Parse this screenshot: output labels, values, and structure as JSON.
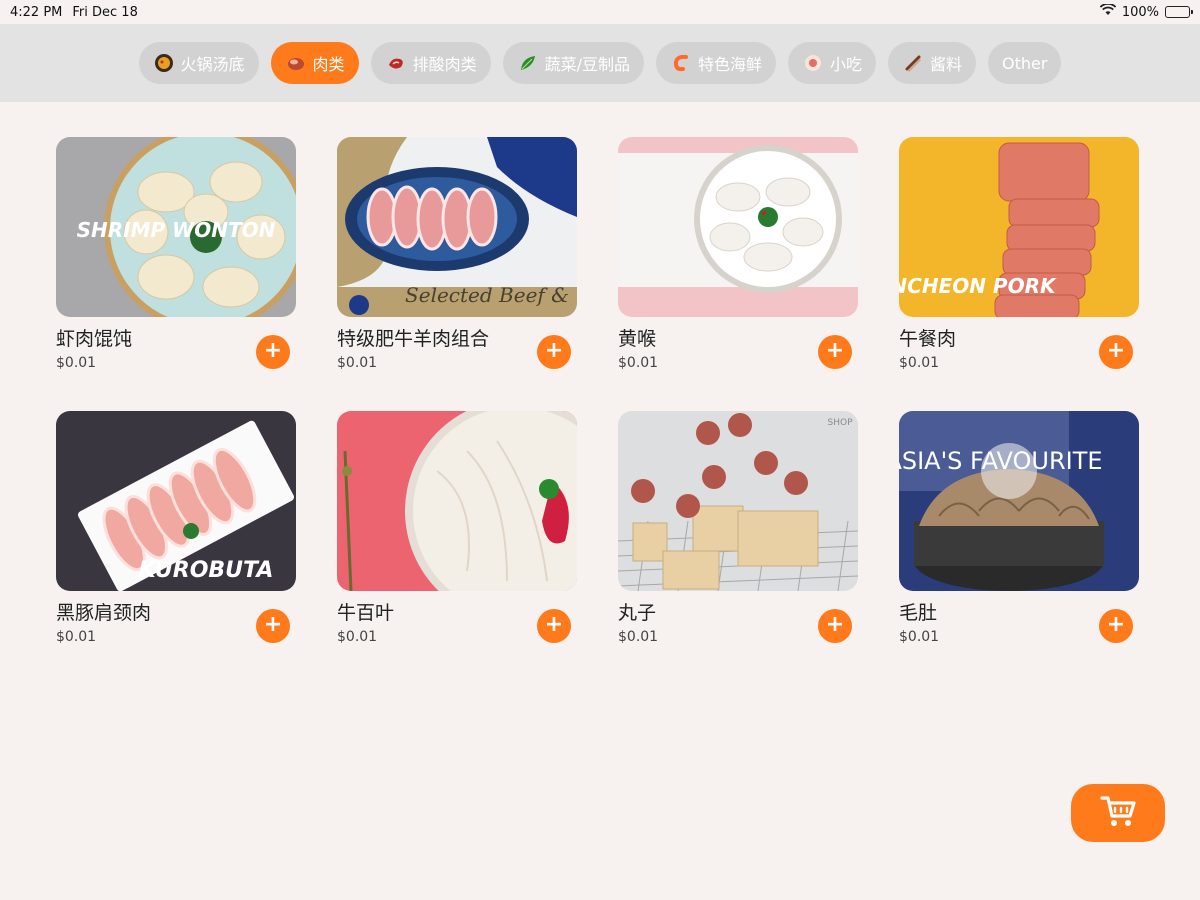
{
  "status": {
    "time": "4:22 PM",
    "date": "Fri Dec 18",
    "battery": "100%",
    "battery_level": 1.0
  },
  "categories": [
    {
      "label": "火锅汤底",
      "icon": "hotpot-icon",
      "active": false
    },
    {
      "label": "肉类",
      "icon": "meat-icon",
      "active": true
    },
    {
      "label": "排酸肉类",
      "icon": "steak-icon",
      "active": false
    },
    {
      "label": "蔬菜/豆制品",
      "icon": "vegetable-icon",
      "active": false
    },
    {
      "label": "特色海鲜",
      "icon": "shrimp-icon",
      "active": false
    },
    {
      "label": "小吃",
      "icon": "snack-icon",
      "active": false
    },
    {
      "label": "酱料",
      "icon": "sauce-icon",
      "active": false
    },
    {
      "label": "Other",
      "icon": "",
      "active": false
    }
  ],
  "products": [
    {
      "name": "虾肉馄饨",
      "price": "$0.01",
      "image_text": "SHRIMP WONTON"
    },
    {
      "name": "特级肥牛羊肉组合",
      "price": "$0.01",
      "image_text": "Selected Beef &"
    },
    {
      "name": "黄喉",
      "price": "$0.01",
      "image_text": ""
    },
    {
      "name": "午餐肉",
      "price": "$0.01",
      "image_text": "LUNCHEON PORK"
    },
    {
      "name": "黑豚肩颈肉",
      "price": "$0.01",
      "image_text": "KUROBUTA"
    },
    {
      "name": "牛百叶",
      "price": "$0.01",
      "image_text": ""
    },
    {
      "name": "丸子",
      "price": "$0.01",
      "image_text": "SHOP"
    },
    {
      "name": "毛肚",
      "price": "$0.01",
      "image_text": "ASIA'S FAVOURITE"
    }
  ],
  "add_label": "+",
  "colors": {
    "accent": "#ff7a1a",
    "pill_inactive": "#d2d2d2",
    "category_bar": "#e3e3e3",
    "background": "#f7f1f0"
  },
  "icons": {
    "cart": "cart-icon",
    "wifi": "wifi-icon",
    "battery": "battery-icon"
  }
}
